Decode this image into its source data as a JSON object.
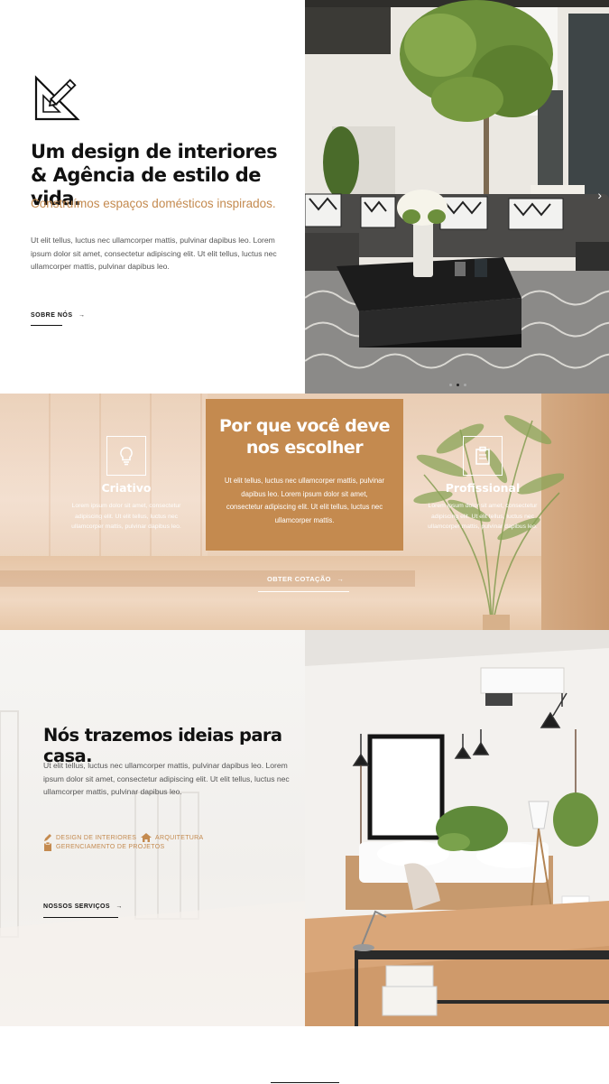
{
  "hero": {
    "title": "Um design de interiores & Agência de estilo de vida.",
    "subtitle": "Construímos espaços domésticos inspirados.",
    "body": "Ut elit tellus, luctus nec ullamcorper mattis, pulvinar dapibus leo. Lorem ipsum dolor sit amet, consectetur adipiscing elit. Ut elit tellus, luctus nec ullamcorper mattis, pulvinar dapibus leo.",
    "link_label": "SOBRE NÓS",
    "arrow": "→",
    "slider_next_icon": "chevron-right-icon",
    "slider_dots": 3
  },
  "why": {
    "title": "Por que você deve nos escolher",
    "body": "Ut elit tellus, luctus nec ullamcorper mattis, pulvinar dapibus leo. Lorem ipsum dolor sit amet, consectetur adipiscing elit. Ut elit tellus, luctus nec ullamcorper mattis.",
    "features": [
      {
        "title": "Criativo",
        "icon": "lightbulb-icon",
        "text": "Lorem ipsum dolor sit amet, consectetur adipiscing elit. Ut elit tellus, luctus nec ullamcorper mattis, pulvinar dapibus leo."
      },
      {
        "title": "Profissional",
        "icon": "clipboard-icon",
        "text": "Lorem ipsum dolor sit amet, consectetur adipiscing elit. Ut elit tellus, luctus nec ullamcorper mattis, pulvinar dapibus leo."
      }
    ],
    "cta_label": "OBTER COTAÇÃO",
    "arrow": "→"
  },
  "ideas": {
    "title": "Nós trazemos ideias para casa.",
    "body": "Ut elit tellus, luctus nec ullamcorper mattis, pulvinar dapibus leo. Lorem ipsum dolor sit amet, consectetur adipiscing elit. Ut elit tellus, luctus nec ullamcorper mattis, pulvinar dapibus leo.",
    "services": [
      {
        "label": "DESIGN DE INTERIORES",
        "icon": "pencil-icon"
      },
      {
        "label": "ARQUITETURA",
        "icon": "home-icon"
      },
      {
        "label": "GERENCIAMENTO DE PROJETOS",
        "icon": "clipboard-icon"
      }
    ],
    "link_label": "NOSSOS SERVIÇOS",
    "arrow": "→"
  },
  "colors": {
    "accent": "#c48a4f",
    "text_dark": "#111111",
    "text_body": "#555555"
  }
}
